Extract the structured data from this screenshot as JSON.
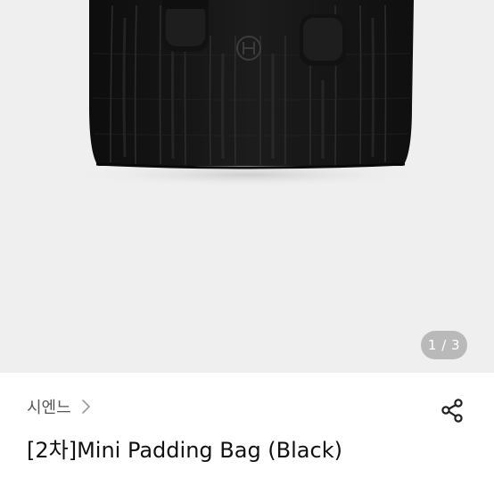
{
  "gallery": {
    "image_alt": "black quilted padded tote bag product photo",
    "counter_current": "1",
    "counter_separator": " / ",
    "counter_total": "3"
  },
  "product": {
    "brand": "시엔느",
    "title": "[2차]Mini Padding Bag (Black)"
  },
  "icons": {
    "brand_chevron": "chevron-right-icon",
    "share": "share-icon",
    "bag_logo": "brand-monogram-logo"
  },
  "colors": {
    "photo_background": "#efefef",
    "bag": "#161616",
    "counter_badge": "#b9b9b9",
    "title_text": "#111111",
    "brand_text": "#555555"
  }
}
